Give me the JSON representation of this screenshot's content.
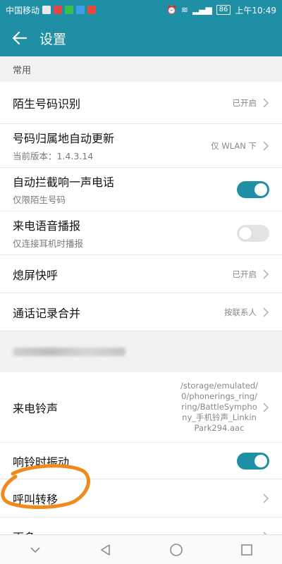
{
  "status_bar": {
    "carrier": "中国移动",
    "battery": "86",
    "time": "上午10:49"
  },
  "app_bar": {
    "title": "设置"
  },
  "sections": {
    "common_header": "常用"
  },
  "rows": {
    "unknown_number": {
      "label": "陌生号码识别",
      "value": "已开启"
    },
    "location_update": {
      "label": "号码归属地自动更新",
      "sub": "当前版本：1.4.3.14",
      "value": "仅 WLAN 下"
    },
    "block_one_ring": {
      "label": "自动拦截响一声电话",
      "sub": "仅限陌生号码",
      "toggle": true
    },
    "voice_broadcast": {
      "label": "来电语音播报",
      "sub": "仅连接耳机时播报",
      "toggle": false
    },
    "screen_off_call": {
      "label": "熄屏快呼",
      "value": "已开启"
    },
    "merge_logs": {
      "label": "通话记录合并",
      "value": "按联系人"
    },
    "ringtone": {
      "label": "来电铃声",
      "value": "/storage/emulated/0/phonerings_ring/ring/BattleSymphony_手机铃声_LinkinPark294.aac"
    },
    "vibrate": {
      "label": "响铃时振动",
      "toggle": true
    },
    "call_forwarding": {
      "label": "呼叫转移"
    },
    "more": {
      "label": "更多"
    }
  },
  "colors": {
    "accent": "#1f8fa6",
    "annotation": "#f08a1c"
  }
}
